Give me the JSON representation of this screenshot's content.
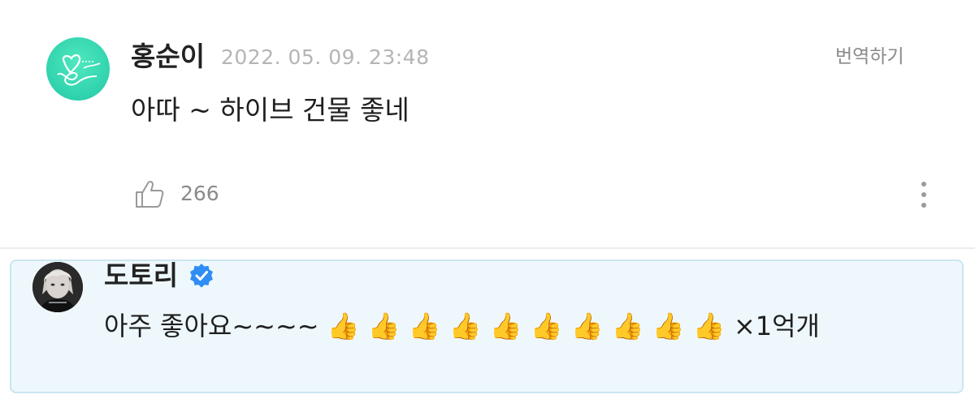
{
  "comment": {
    "author": "홍순이",
    "timestamp": "2022. 05. 09. 23:48",
    "translate_label": "번역하기",
    "text": "아따 ~ 하이브 건물 좋네",
    "like_count": "266",
    "avatar_icon": "heart-signature-avatar",
    "like_icon": "thumbs-up-outline-icon",
    "more_icon": "vertical-ellipsis-icon"
  },
  "reply": {
    "author": "도토리",
    "verified_icon": "verified-badge-icon",
    "text": "아주 좋아요~~~~ 👍 👍 👍 👍 👍 👍 👍 👍 👍 👍 ×1억개",
    "avatar_icon": "profile-photo-avatar"
  },
  "colors": {
    "avatar_teal": "#2fd2ad",
    "timestamp_gray": "#b5b5b5",
    "reply_background": "#eef8fc",
    "reply_border": "#c9e6f0",
    "verified_blue": "#2f8df5"
  }
}
